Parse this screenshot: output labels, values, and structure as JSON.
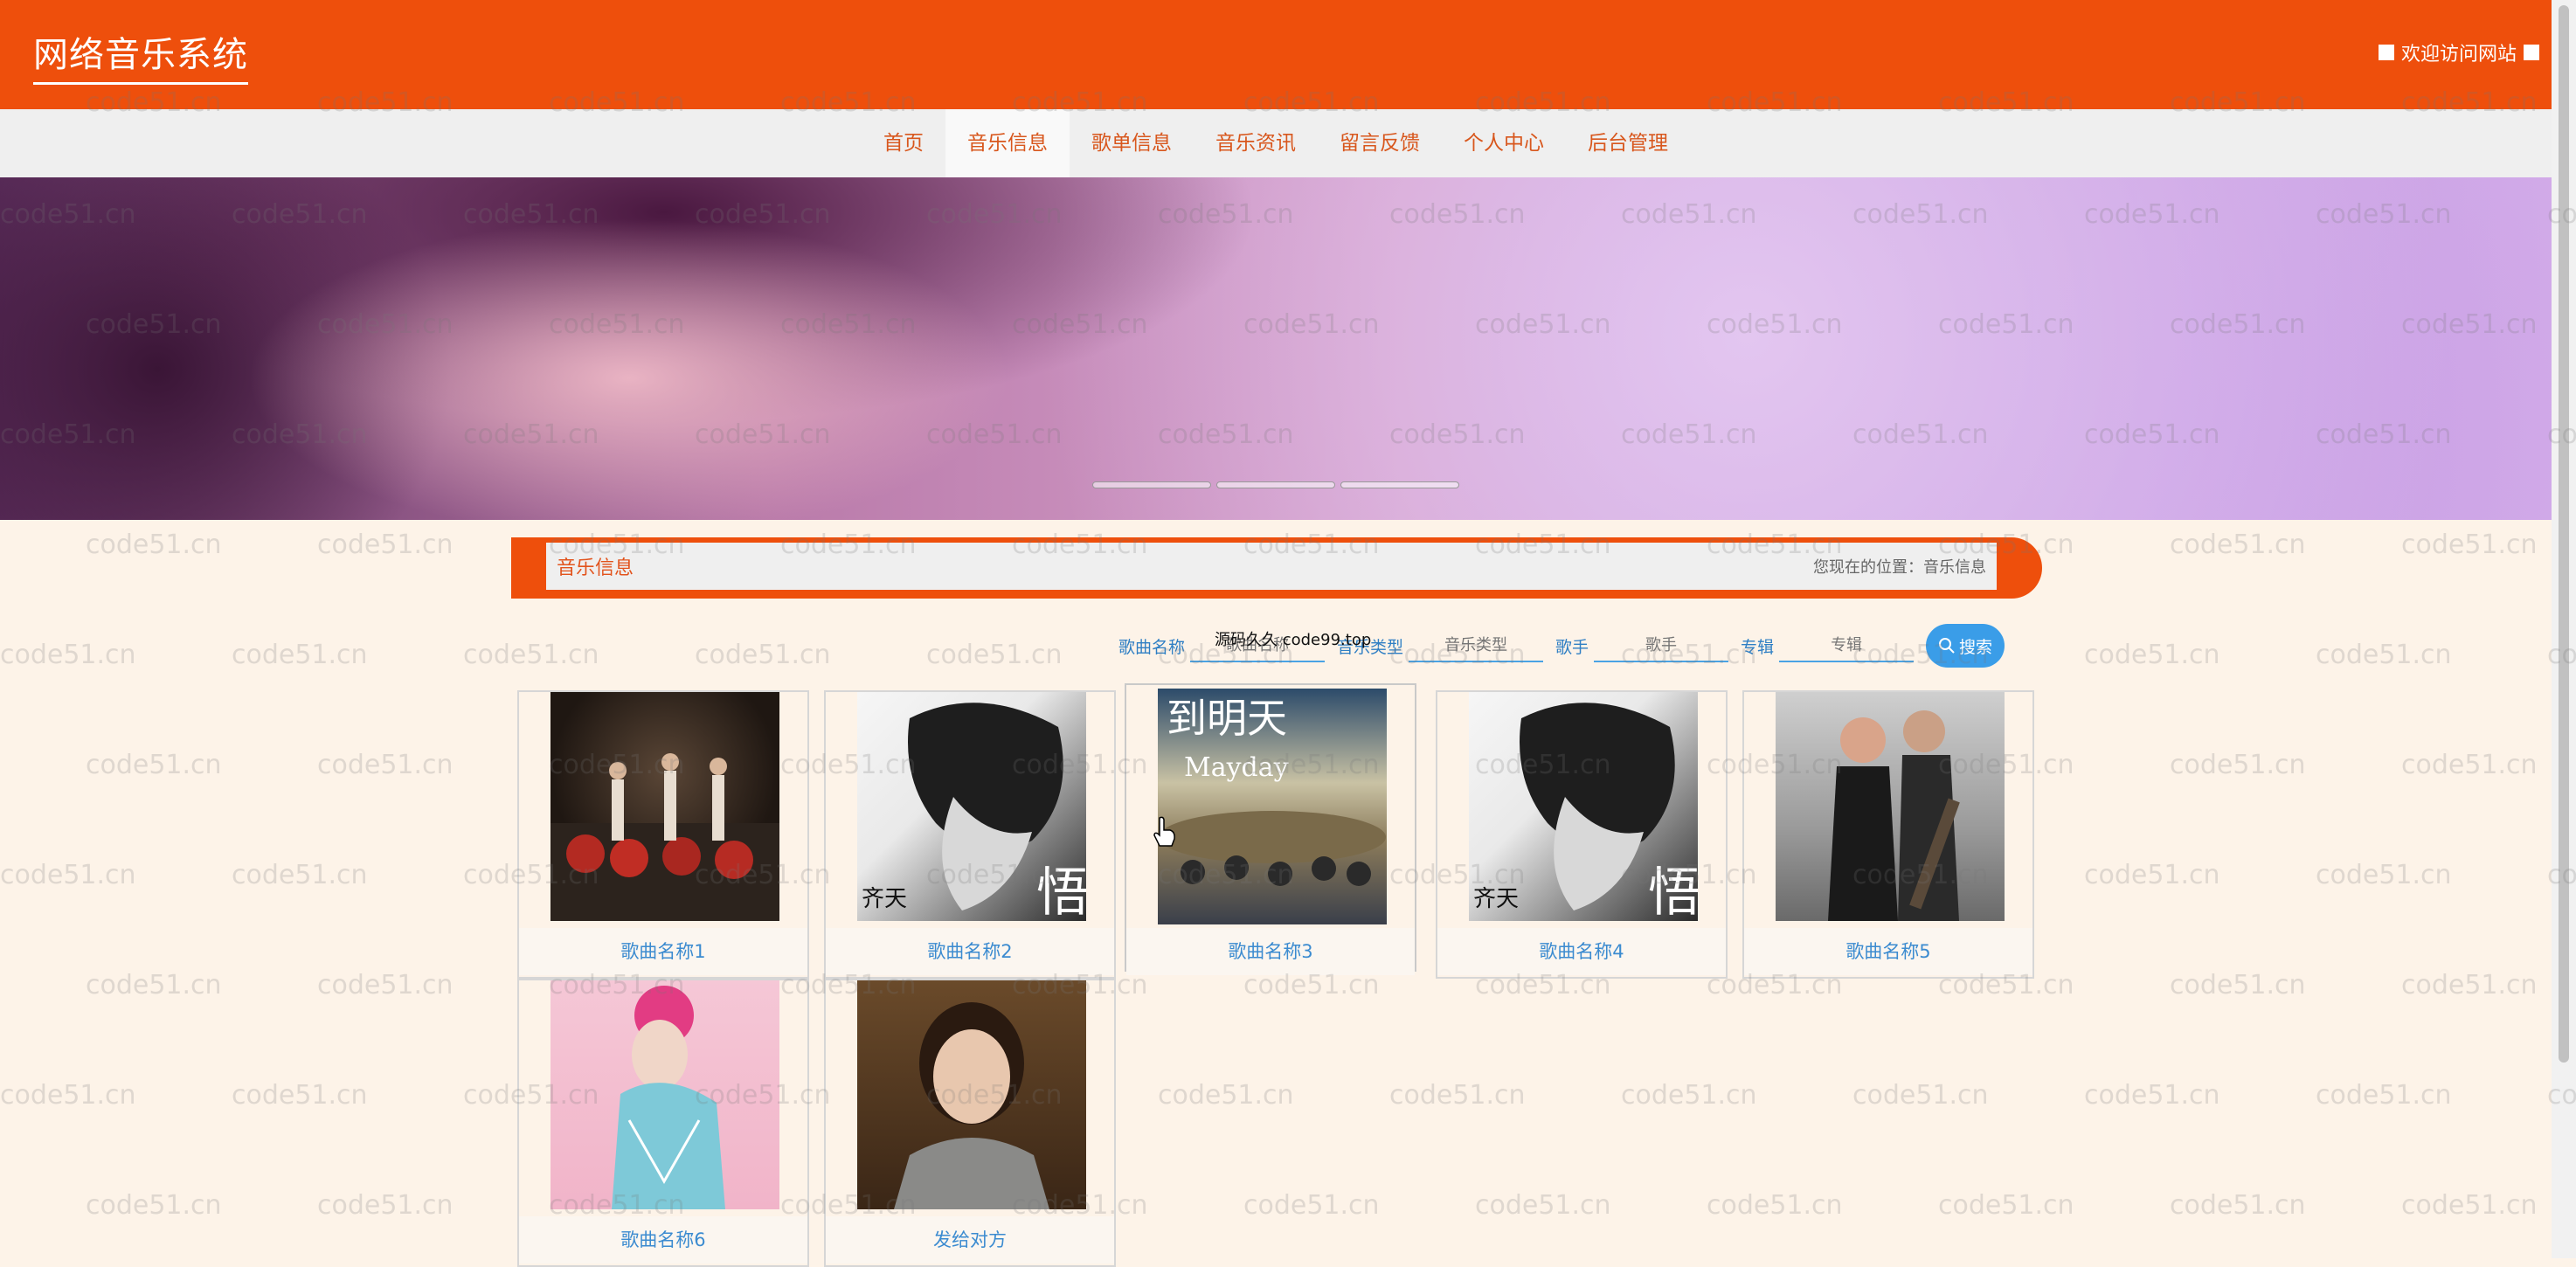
{
  "header": {
    "site_title": "网络音乐系统",
    "welcome_text": "欢迎访问网站"
  },
  "nav": {
    "items": [
      {
        "label": "首页"
      },
      {
        "label": "音乐信息"
      },
      {
        "label": "歌单信息"
      },
      {
        "label": "音乐资讯"
      },
      {
        "label": "留言反馈"
      },
      {
        "label": "个人中心"
      },
      {
        "label": "后台管理"
      }
    ],
    "active": "音乐信息"
  },
  "section": {
    "title": "音乐信息",
    "breadcrumb": "您现在的位置：音乐信息"
  },
  "search": {
    "song_label": "歌曲名称",
    "song_placeholder": "歌曲名称",
    "type_label": "音乐类型",
    "type_placeholder": "音乐类型",
    "singer_label": "歌手",
    "singer_placeholder": "歌手",
    "album_label": "专辑",
    "album_placeholder": "专辑",
    "button_label": "搜索",
    "tooltip": "源码久久 code99.top"
  },
  "cards": [
    {
      "title": "歌曲名称1"
    },
    {
      "title": "歌曲名称2"
    },
    {
      "title": "歌曲名称3"
    },
    {
      "title": "歌曲名称4"
    },
    {
      "title": "歌曲名称5"
    },
    {
      "title": "歌曲名称6"
    },
    {
      "title": "发给对方"
    }
  ],
  "watermark": "code51.cn",
  "colors": {
    "brand": "#ee4f0c",
    "link": "#3b8bd0",
    "button": "#3a9de8",
    "page_bg": "#fdf3e8"
  }
}
